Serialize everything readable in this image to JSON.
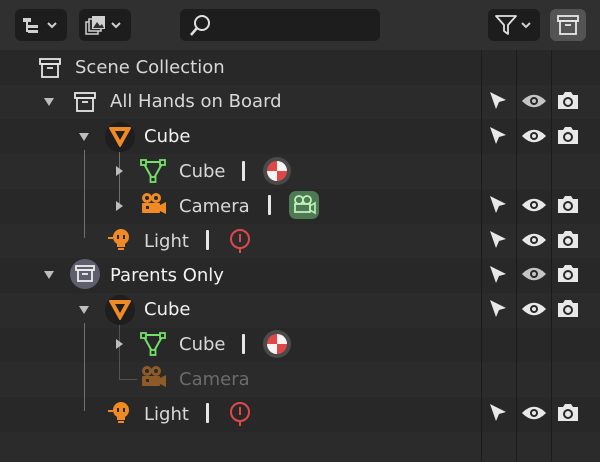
{
  "header": {
    "search_placeholder": "",
    "buttons": [
      {
        "name": "display-mode-button",
        "icon": "outliner-list-icon"
      },
      {
        "name": "view-filter-button",
        "icon": "image-gallery-icon"
      },
      {
        "name": "filter-dropdown-button",
        "icon": "funnel-icon"
      },
      {
        "name": "new-collection-button",
        "icon": "collection-box-icon"
      }
    ]
  },
  "rows": [
    {
      "label": "Scene Collection",
      "icon": "collection-box-icon"
    },
    {
      "label": "All Hands on Board",
      "icon": "collection-box-icon"
    },
    {
      "label": "Cube",
      "icon": "object-mesh-icon"
    },
    {
      "label": "Cube",
      "icon": "mesh-data-icon"
    },
    {
      "label": "Camera",
      "icon": "camera-object-icon"
    },
    {
      "label": "Light",
      "icon": "light-object-icon"
    },
    {
      "label": "Parents Only",
      "icon": "collection-box-icon"
    },
    {
      "label": "Cube",
      "icon": "object-mesh-icon"
    },
    {
      "label": "Cube",
      "icon": "mesh-data-icon"
    },
    {
      "label": "Camera",
      "icon": "camera-object-icon"
    },
    {
      "label": "Light",
      "icon": "light-object-icon"
    }
  ],
  "colors": {
    "background": "#282828",
    "header": "#303030",
    "object_orange": "#f08a24",
    "mesh_green": "#73e066",
    "material_red": "#e04848",
    "camera_data_green": "#5fbf6a"
  }
}
